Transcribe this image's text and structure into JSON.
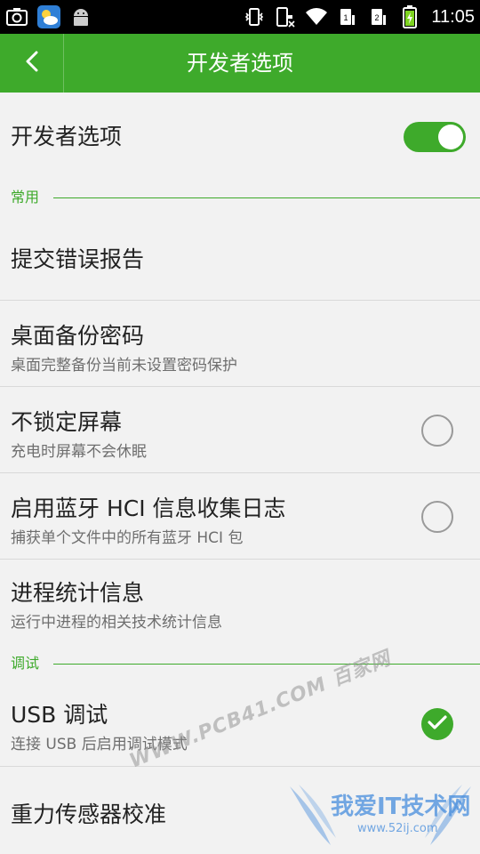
{
  "status_bar": {
    "time": "11:05",
    "left_icons": [
      "screenshot-icon",
      "weather-icon",
      "android-icon"
    ],
    "right_icons": [
      "vibrate-icon",
      "mute-icon",
      "wifi-icon",
      "sim1-icon",
      "sim2-icon",
      "battery-icon"
    ]
  },
  "action_bar": {
    "title": "开发者选项",
    "back_icon": "chevron-left-icon"
  },
  "master_toggle": {
    "label": "开发者选项",
    "on": true
  },
  "sections": {
    "common": "常用",
    "debug": "调试"
  },
  "items": [
    {
      "title": "提交错误报告",
      "subtitle": ""
    },
    {
      "title": "桌面备份密码",
      "subtitle": "桌面完整备份当前未设置密码保护"
    },
    {
      "title": "不锁定屏幕",
      "subtitle": "充电时屏幕不会休眠",
      "checked": false
    },
    {
      "title": "启用蓝牙 HCI 信息收集日志",
      "subtitle": "捕获单个文件中的所有蓝牙 HCI 包",
      "checked": false
    },
    {
      "title": "进程统计信息",
      "subtitle": "运行中进程的相关技术统计信息"
    },
    {
      "title": "USB 调试",
      "subtitle": "连接 USB 后启用调试模式",
      "checked": true
    },
    {
      "title": "重力传感器校准",
      "subtitle": ""
    }
  ],
  "watermarks": {
    "diagonal": "WWW.PCB41.COM 百家网",
    "logo_text": "我爱IT技术网",
    "logo_url": "www.52ij.com"
  },
  "colors": {
    "accent": "#3eaa2b",
    "status_bar": "#000000",
    "background": "#f2f2f2"
  }
}
